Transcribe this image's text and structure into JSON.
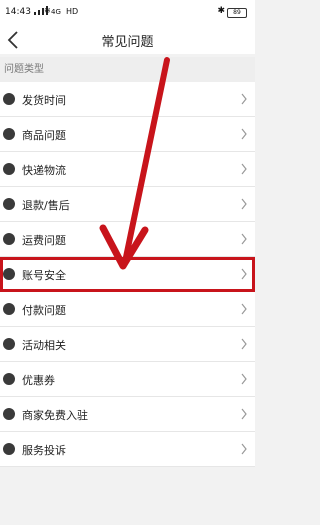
{
  "status_bar": {
    "time": "14:43",
    "network": "4G",
    "hd": "HD",
    "bluetooth": "✱",
    "battery": "89"
  },
  "nav": {
    "title": "常见问题",
    "back_icon": "chevron-left-icon"
  },
  "section": {
    "title": "问题类型"
  },
  "items": [
    {
      "label": "发货时间",
      "icon": "shipping-time-icon"
    },
    {
      "label": "商品问题",
      "icon": "product-icon"
    },
    {
      "label": "快递物流",
      "icon": "truck-icon"
    },
    {
      "label": "退款/售后",
      "icon": "refund-icon"
    },
    {
      "label": "运费问题",
      "icon": "shipping-fee-icon"
    },
    {
      "label": "账号安全",
      "icon": "shield-icon",
      "highlighted": true
    },
    {
      "label": "付款问题",
      "icon": "payment-icon"
    },
    {
      "label": "活动相关",
      "icon": "gift-icon"
    },
    {
      "label": "优惠券",
      "icon": "coupon-icon"
    },
    {
      "label": "商家免费入驻",
      "icon": "store-icon"
    },
    {
      "label": "服务投诉",
      "icon": "complaint-icon"
    }
  ],
  "annotation": {
    "color": "#c8141b"
  }
}
